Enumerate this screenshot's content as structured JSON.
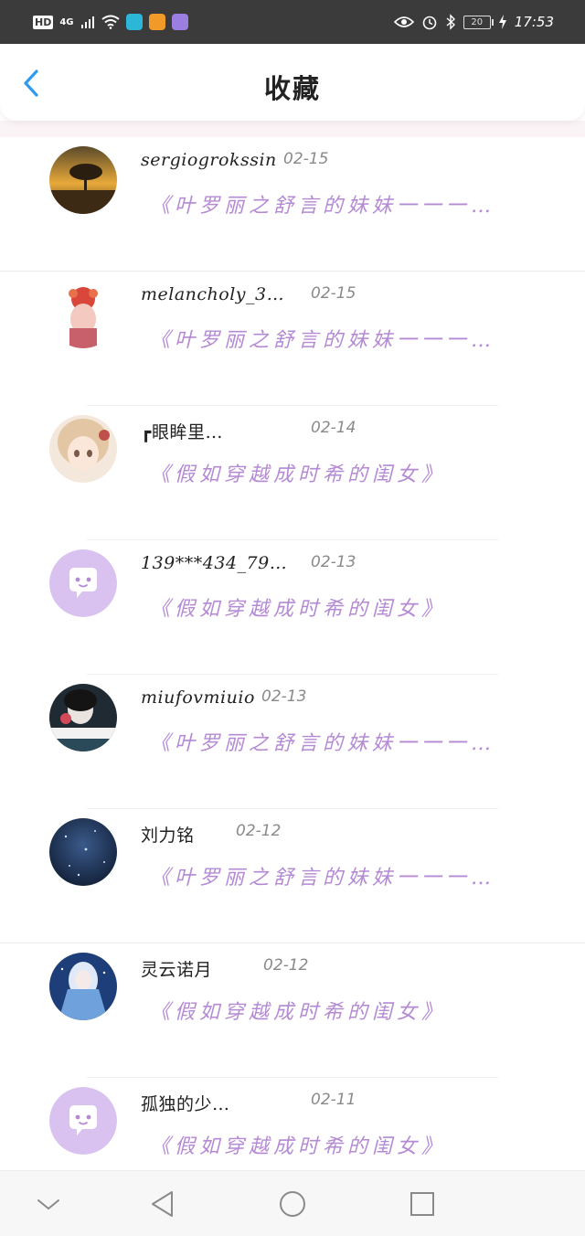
{
  "status_bar": {
    "left_badge": "HD",
    "network": "4G",
    "battery": "20",
    "time": "17:53",
    "icons": [
      "signal-icon",
      "wifi-icon",
      "shield-app-icon",
      "video-app-icon",
      "music-app-icon",
      "eye-icon",
      "alarm-icon",
      "bluetooth-icon",
      "battery-icon",
      "charging-icon"
    ]
  },
  "header": {
    "title": "收藏",
    "back_icon": "chevron-left-icon"
  },
  "favorites": [
    {
      "username": "sergiogrokssin",
      "date": "02-15",
      "book": "《叶罗丽之舒言的妹妹一一一…"
    },
    {
      "username": "melancholy_3…",
      "date": "02-15",
      "book": "《叶罗丽之舒言的妹妹一一一…"
    },
    {
      "username": "┏眼眸里…",
      "date": "02-14",
      "book": "《假如穿越成时希的闺女》"
    },
    {
      "username": "139***434_79…",
      "date": "02-13",
      "book": "《假如穿越成时希的闺女》"
    },
    {
      "username": "miufovmiuio",
      "date": "02-13",
      "book": "《叶罗丽之舒言的妹妹一一一…"
    },
    {
      "username": "刘力铭",
      "date": "02-12",
      "book": "《叶罗丽之舒言的妹妹一一一…"
    },
    {
      "username": "灵云诺月",
      "date": "02-12",
      "book": "《假如穿越成时希的闺女》"
    },
    {
      "username": "孤独的少…",
      "date": "02-11",
      "book": "《假如穿越成时希的闺女》"
    }
  ],
  "colors": {
    "accent": "#2e9bf0",
    "book_title": "#b48ad4",
    "default_avatar": "#d9c2f0",
    "status_bar": "#3b3b3b"
  },
  "nav_icons": [
    "back-triangle-icon",
    "home-circle-icon",
    "recents-square-icon",
    "collapse-chevron-icon"
  ]
}
